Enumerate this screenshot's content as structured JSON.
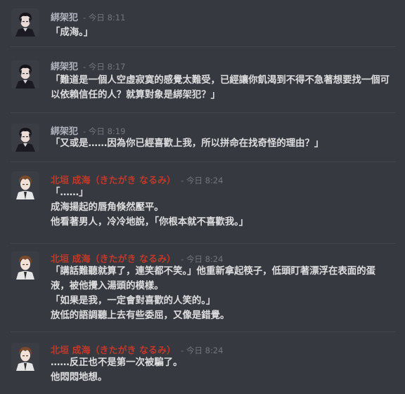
{
  "messages": [
    {
      "author": "綁架犯",
      "timestamp": "- 今日 8:11",
      "avatar": "dark-haired-man-avatar",
      "lines": [
        "「成海。」"
      ]
    },
    {
      "author": "綁架犯",
      "timestamp": "- 今日 8:17",
      "avatar": "dark-haired-man-avatar",
      "lines": [
        "「難道是一個人空虛寂寞的感覺太難受，已經讓你飢渴到不得不急著想要找一個可以依賴信任的人？就算對象是綁架犯？」"
      ]
    },
    {
      "author": "綁架犯",
      "timestamp": "- 今日 8:19",
      "avatar": "dark-haired-man-avatar",
      "lines": [
        "「又或是……因為你已經喜歡上我，所以拼命在找奇怪的理由？」"
      ]
    },
    {
      "author": "北垣 成海（きたがき なるみ）",
      "timestamp": "- 今日 8:24",
      "avatar": "brown-haired-man-avatar",
      "lines": [
        "「……」",
        "成海揚起的唇角倏然壓平。",
        "他看著男人，冷冷地說，「你根本就不喜歡我。」"
      ]
    },
    {
      "author": "北垣 成海（きたがき なるみ）",
      "timestamp": "- 今日 8:24",
      "avatar": "brown-haired-man-avatar",
      "lines": [
        "「講話難聽就算了，連笑都不笑。」他重新拿起筷子，低頭盯著漂浮在表面的蛋液，被他攪入湯頭的模樣。",
        "「如果是我，一定會對喜歡的人笑的。」",
        "放低的語調聽上去有些委屈，又像是錯覺。"
      ]
    },
    {
      "author": "北垣 成海（きたがき なるみ）",
      "timestamp": "- 今日 8:24",
      "avatar": "brown-haired-man-avatar",
      "lines": [
        "……反正也不是第一次被騙了。",
        "他悶悶地想。"
      ]
    }
  ],
  "colors": {
    "background": "#36393f",
    "kidnapper_name": "#b0b3bd",
    "kitagaki_name": "#c0392b",
    "timestamp": "#72767d",
    "text": "#dcddde"
  }
}
